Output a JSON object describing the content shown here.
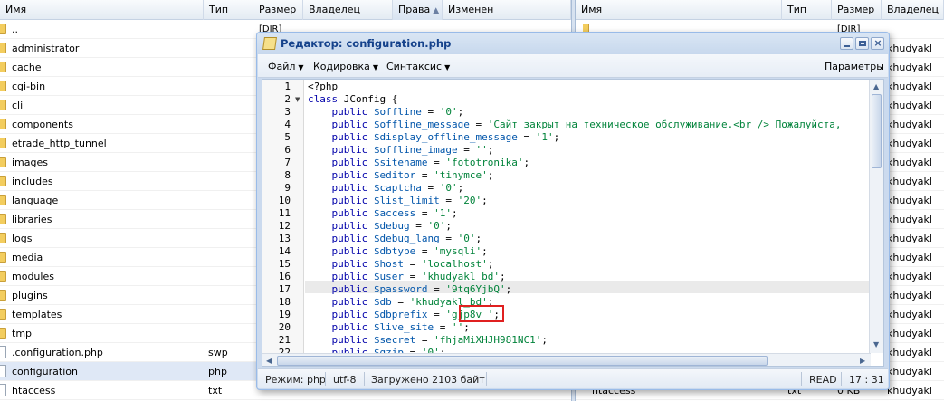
{
  "left_panel": {
    "columns": {
      "name": "Имя",
      "type": "Тип",
      "size": "Размер",
      "owner": "Владелец",
      "perms": "Права",
      "modified": "Изменен"
    },
    "rows": [
      {
        "name": "..",
        "type": "",
        "size": "[DIR]",
        "icon": "folder-icon"
      },
      {
        "name": "administrator",
        "type": "",
        "size": "",
        "icon": "folder-icon"
      },
      {
        "name": "cache",
        "type": "",
        "size": "",
        "icon": "folder-icon"
      },
      {
        "name": "cgi-bin",
        "type": "",
        "size": "",
        "icon": "folder-icon"
      },
      {
        "name": "cli",
        "type": "",
        "size": "",
        "icon": "folder-icon"
      },
      {
        "name": "components",
        "type": "",
        "size": "",
        "icon": "folder-icon"
      },
      {
        "name": "etrade_http_tunnel",
        "type": "",
        "size": "",
        "icon": "folder-icon"
      },
      {
        "name": "images",
        "type": "",
        "size": "",
        "icon": "folder-icon"
      },
      {
        "name": "includes",
        "type": "",
        "size": "",
        "icon": "folder-icon"
      },
      {
        "name": "language",
        "type": "",
        "size": "",
        "icon": "folder-icon"
      },
      {
        "name": "libraries",
        "type": "",
        "size": "",
        "icon": "folder-icon"
      },
      {
        "name": "logs",
        "type": "",
        "size": "",
        "icon": "folder-icon"
      },
      {
        "name": "media",
        "type": "",
        "size": "",
        "icon": "folder-icon"
      },
      {
        "name": "modules",
        "type": "",
        "size": "",
        "icon": "folder-icon"
      },
      {
        "name": "plugins",
        "type": "",
        "size": "",
        "icon": "folder-icon"
      },
      {
        "name": "templates",
        "type": "",
        "size": "",
        "icon": "folder-icon"
      },
      {
        "name": "tmp",
        "type": "",
        "size": "",
        "icon": "folder-icon"
      },
      {
        "name": ".configuration.php",
        "type": "swp",
        "size": "",
        "icon": "file-icon"
      },
      {
        "name": "configuration",
        "type": "php",
        "size": "",
        "icon": "file-icon"
      },
      {
        "name": "htaccess",
        "type": "txt",
        "size": "",
        "icon": "file-icon"
      }
    ]
  },
  "right_panel": {
    "columns": {
      "name": "Имя",
      "type": "Тип",
      "size": "Размер",
      "owner": "Владелец"
    },
    "first_size": "[DIR]",
    "owner_value": "khudyakl",
    "last_name": "htaccess",
    "last_type": "txt",
    "last_size": "0 KB"
  },
  "editor": {
    "title": "Редактор: configuration.php",
    "menu": {
      "file": "Файл",
      "encoding": "Кодировка",
      "syntax": "Синтаксис",
      "params": "Параметры"
    },
    "lines": [
      "<?php",
      "class JConfig {",
      "    public $offline = '0';",
      "    public $offline_message = 'Сайт закрыт на техническое обслуживание.<br /> Пожалуйста,",
      "    public $display_offline_message = '1';",
      "    public $offline_image = '';",
      "    public $sitename = 'fototronika';",
      "    public $editor = 'tinymce';",
      "    public $captcha = '0';",
      "    public $list_limit = '20';",
      "    public $access = '1';",
      "    public $debug = '0';",
      "    public $debug_lang = '0';",
      "    public $dbtype = 'mysqli';",
      "    public $host = 'localhost';",
      "    public $user = 'khudyakl_bd';",
      "    public $password = '9tq6YjbQ';",
      "    public $db = 'khudyakl_bd';",
      "    public $dbprefix = 'gjp8v_';",
      "    public $live_site = '';",
      "    public $secret = 'fhjaMiXHJH981NC1';",
      "    public $gzip = '0';",
      ""
    ],
    "status": {
      "mode": "Режим: php",
      "charset": "utf-8",
      "loaded": "Загружено 2103 байт",
      "state": "READ",
      "cursor": "17 : 31"
    }
  }
}
